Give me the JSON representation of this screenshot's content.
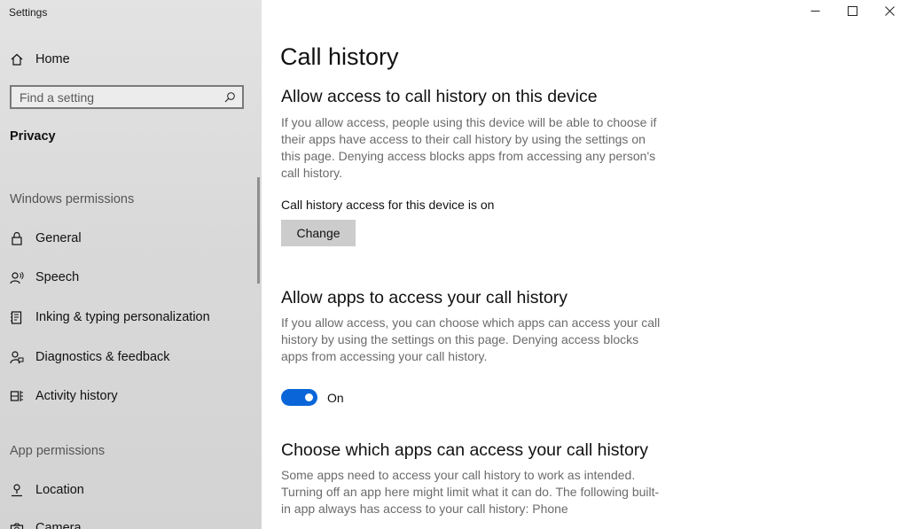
{
  "app": {
    "title": "Settings"
  },
  "sidebar": {
    "home_label": "Home",
    "search": {
      "placeholder": "Find a setting",
      "value": ""
    },
    "current_section": "Privacy",
    "groups": [
      {
        "heading": "Windows permissions",
        "items": [
          {
            "label": "General",
            "icon": "lock-icon"
          },
          {
            "label": "Speech",
            "icon": "speech-icon"
          },
          {
            "label": "Inking & typing personalization",
            "icon": "inking-icon"
          },
          {
            "label": "Diagnostics & feedback",
            "icon": "feedback-icon"
          },
          {
            "label": "Activity history",
            "icon": "activity-icon"
          }
        ]
      },
      {
        "heading": "App permissions",
        "items": [
          {
            "label": "Location",
            "icon": "location-icon"
          },
          {
            "label": "Camera",
            "icon": "camera-icon"
          }
        ]
      }
    ]
  },
  "window_controls": {
    "minimize": "minimize-icon",
    "maximize": "maximize-icon",
    "close": "close-icon"
  },
  "main": {
    "title": "Call history",
    "device_section": {
      "heading": "Allow access to call history on this device",
      "description": "If you allow access, people using this device will be able to choose if their apps have access to their call history by using the settings on this page. Denying access blocks apps from accessing any person's call history.",
      "status": "Call history access for this device is on",
      "button_label": "Change"
    },
    "apps_section": {
      "heading": "Allow apps to access your call history",
      "description": "If you allow access, you can choose which apps can access your call history by using the settings on this page. Denying access blocks apps from accessing your call history.",
      "toggle_state": "On",
      "toggle_on": true
    },
    "choose_section": {
      "heading": "Choose which apps can access your call history",
      "description": "Some apps need to access your call history to work as intended. Turning off an app here might limit what it can do. The following built-in app always has access to your call history: Phone"
    }
  },
  "colors": {
    "accent": "#0a66d8",
    "sidebar_bg": "#dcdcdc",
    "button_bg": "#cccccc",
    "secondary_text": "#6b6b6b"
  }
}
